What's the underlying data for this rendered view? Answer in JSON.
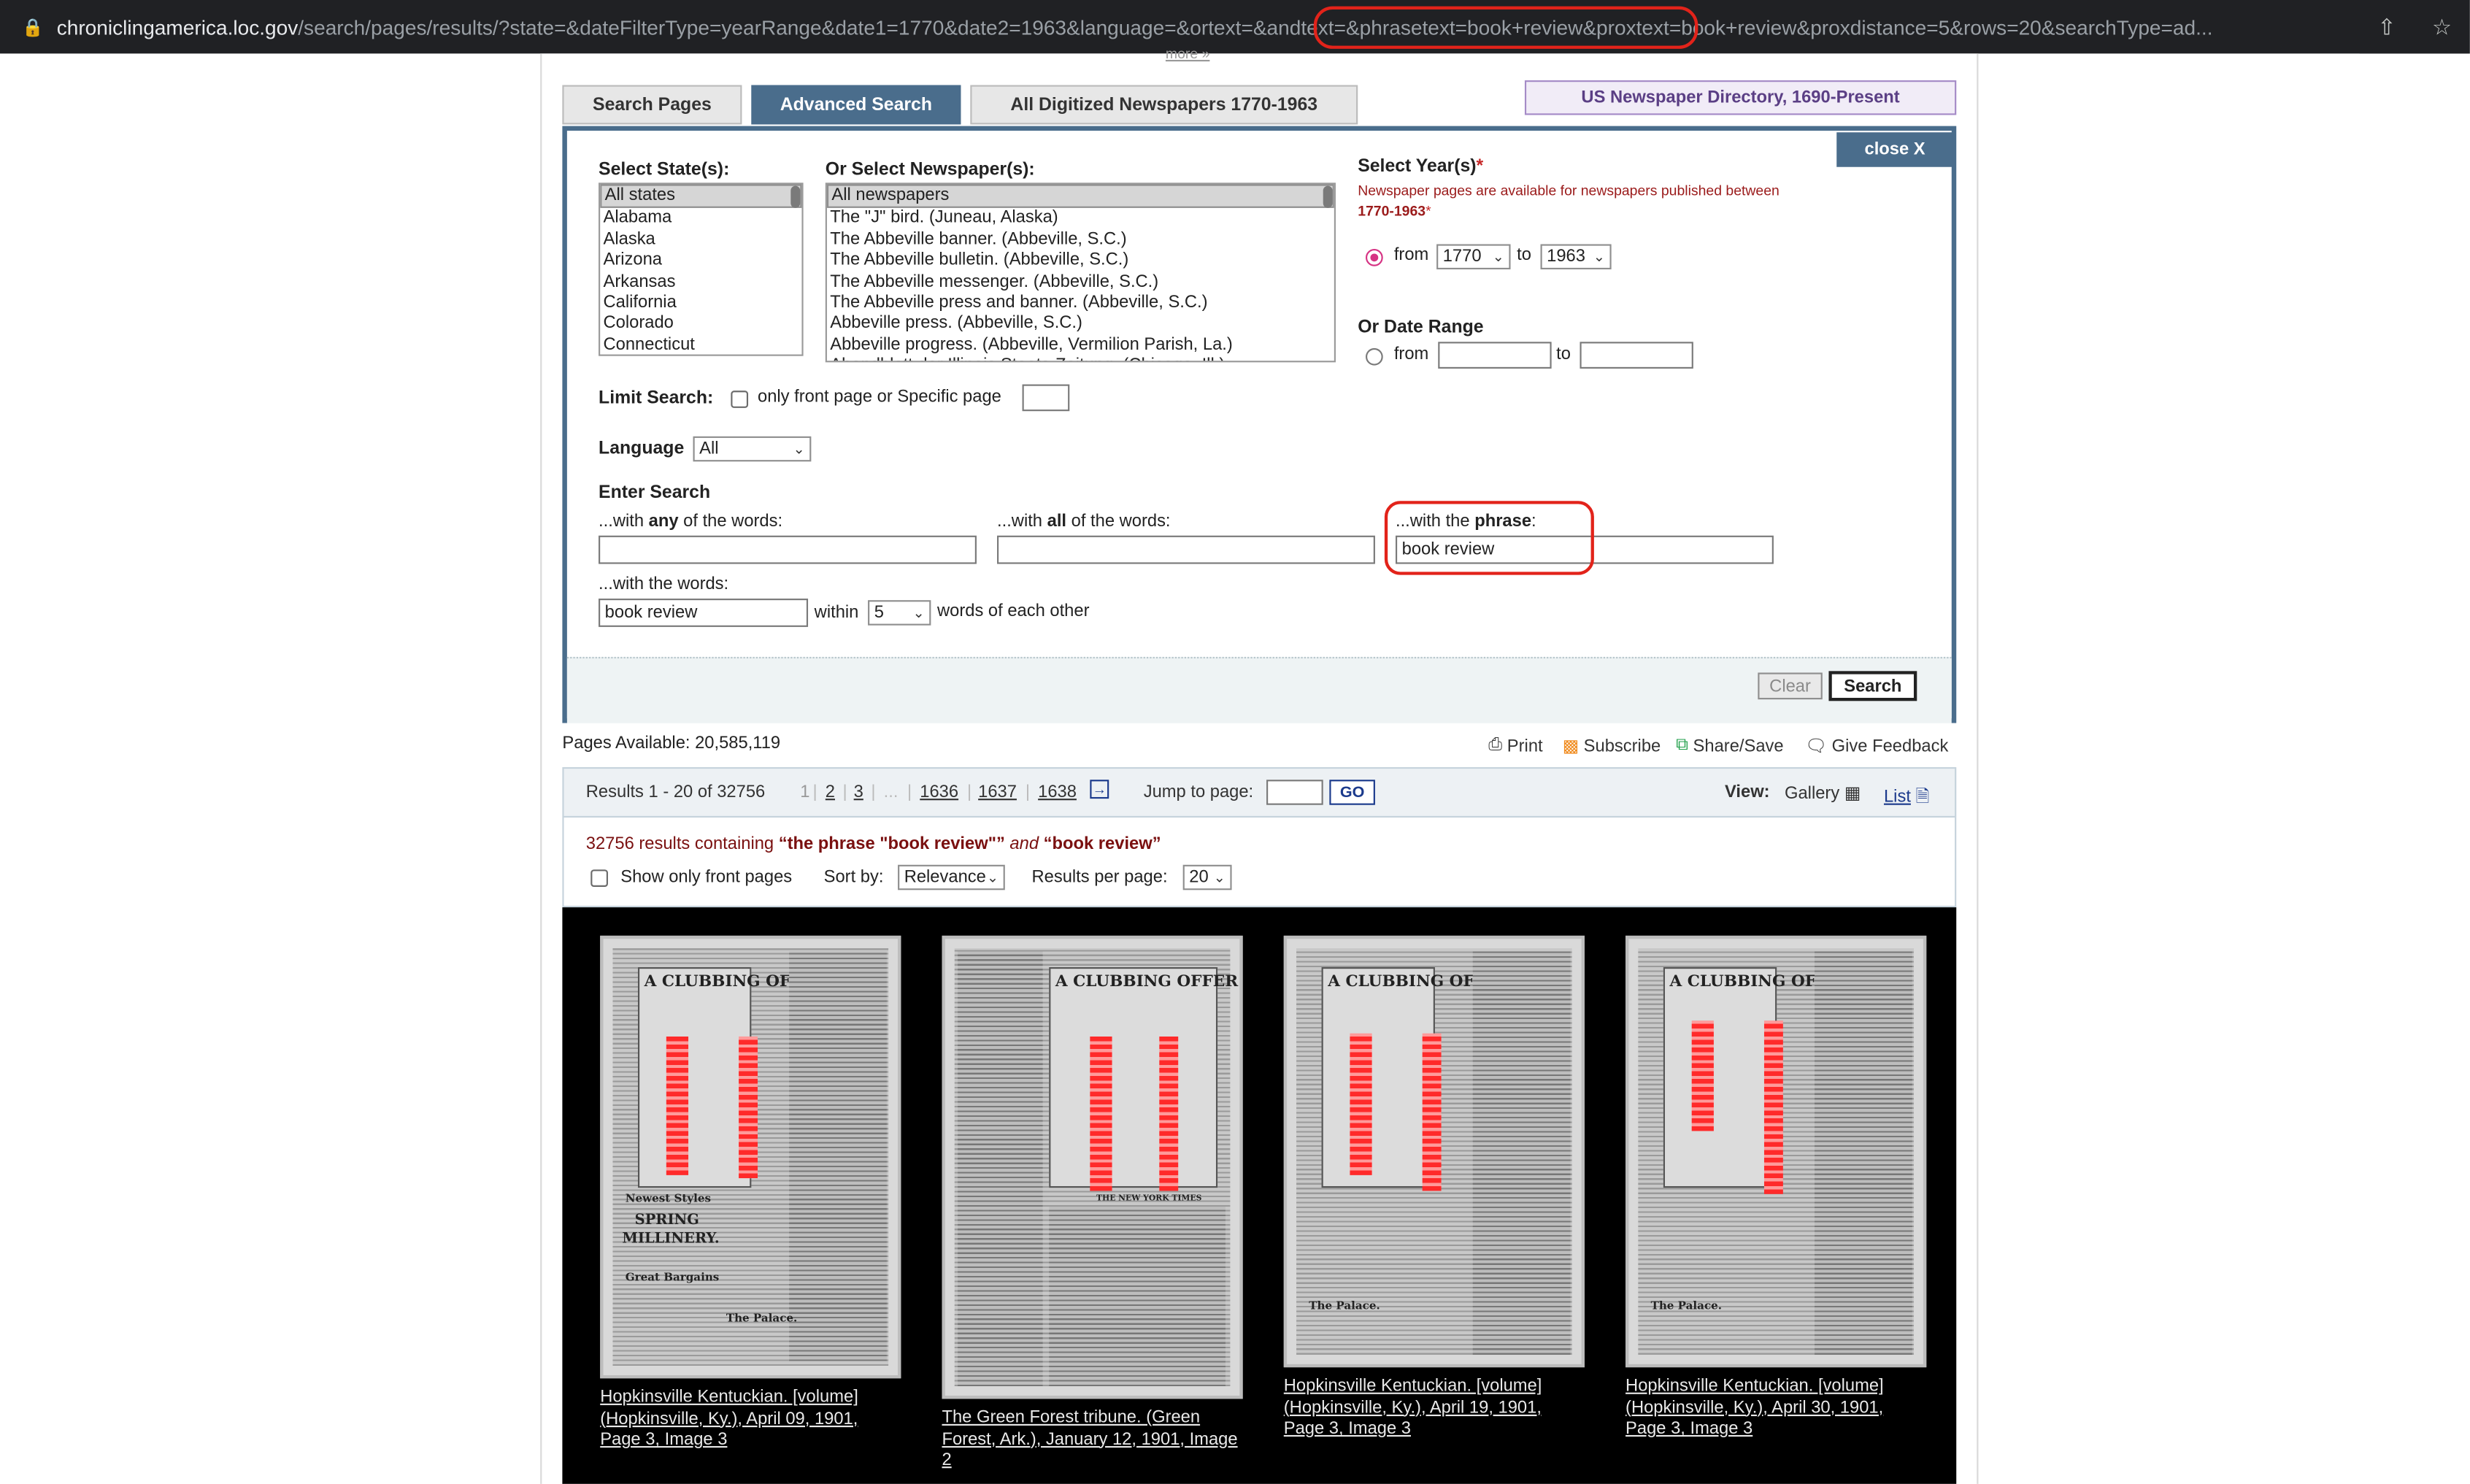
{
  "browser": {
    "url_host": "chroniclingamerica.loc.gov",
    "url_path": "/search/pages/results/?state=&dateFilterType=yearRange&date1=1770&date2=1963&language=&ortext=&andtext=&phrasetext=book+review&proxtext=book+review&proxdistance=5&rows=20&searchType=ad..."
  },
  "tabs": [
    "Search Pages",
    "Advanced Search",
    "All Digitized Newspapers 1770-1963"
  ],
  "directory_tab": "US Newspaper Directory, 1690-Present",
  "more_link": "more »",
  "panel": {
    "close_label": "close X",
    "states_label": "Select State(s):",
    "states": [
      "All states",
      "Alabama",
      "Alaska",
      "Arizona",
      "Arkansas",
      "California",
      "Colorado",
      "Connecticut"
    ],
    "newspapers_label": "Or Select Newspaper(s):",
    "newspapers": [
      "All newspapers",
      "The \"J\" bird. (Juneau, Alaska)",
      "The Abbeville banner. (Abbeville, S.C.)",
      "The Abbeville bulletin. (Abbeville, S.C.)",
      "The Abbeville messenger. (Abbeville, S.C.)",
      "The Abbeville press and banner. (Abbeville, S.C.)",
      "Abbeville press. (Abbeville, S.C.)",
      "Abbeville progress. (Abbeville, Vermilion Parish, La.)",
      "Abendblatt der Illinois Staats-Zeitung. (Chicago, Ill.)"
    ],
    "years_label": "Select Year(s)",
    "years_note": "Newspaper pages are available for newspapers published between",
    "years_range": "1770-1963",
    "from_label": "from",
    "to_label": "to",
    "year_from": "1770",
    "year_to": "1963",
    "date_range_label": "Or Date Range",
    "limit_label": "Limit Search:",
    "limit_text": "only front page or Specific page",
    "language_label": "Language",
    "language_value": "All",
    "enter_search_label": "Enter Search",
    "any_prefix": "...with ",
    "any_bold": "any",
    "any_suffix": " of the words:",
    "all_prefix": "...with ",
    "all_bold": "all",
    "all_suffix": " of the words:",
    "phrase_prefix": "...with the ",
    "phrase_bold": "phrase",
    "phrase_suffix": ":",
    "phrase_value": "book review",
    "words_label": "...with the words:",
    "words_value": "book review",
    "within_label": "within",
    "within_value": "5",
    "within_suffix": "words of each other",
    "clear_label": "Clear",
    "search_label": "Search"
  },
  "pages_available": "Pages Available: 20,585,119",
  "tools": {
    "print": "Print",
    "subscribe": "Subscribe",
    "share": "Share/Save",
    "feedback": "Give Feedback"
  },
  "results_bar": {
    "range": "Results 1 - 20 of 32756",
    "pages": [
      "1",
      "2",
      "3",
      "...",
      "1636",
      "1637",
      "1638"
    ],
    "jump_label": "Jump to page:",
    "go": "GO",
    "view_label": "View:",
    "gallery": "Gallery",
    "list": "List"
  },
  "summary": {
    "count": "32756 results containing ",
    "phrase": "“the phrase \"book review\"”",
    "and": " and ",
    "words": "“book review”"
  },
  "filters": {
    "front_only": "Show only front pages",
    "sort_label": "Sort by:",
    "sort_value": "Relevance",
    "per_page_label": "Results per page:",
    "per_page_value": "20"
  },
  "results": [
    {
      "caption": "Hopkinsville Kentuckian. [volume] (Hopkinsville, Ky.), April 09, 1901, Page 3, Image 3",
      "headline": "A CLUBBING OFFER",
      "extra": [
        "Newest Styles",
        "SPRING",
        "MILLINERY.",
        "Great Bargains",
        "The Palace."
      ]
    },
    {
      "caption": "The Green Forest tribune. (Green Forest, Ark.), January 12, 1901, Image 2",
      "headline": "A CLUBBING OFFER",
      "extra": [
        "THE NEW YORK TIMES"
      ]
    },
    {
      "caption": "Hopkinsville Kentuckian. [volume] (Hopkinsville, Ky.), April 19, 1901, Page 3, Image 3",
      "headline": "A CLUBBING OFFER",
      "extra": [
        "The Palace."
      ]
    },
    {
      "caption": "Hopkinsville Kentuckian. [volume] (Hopkinsville, Ky.), April 30, 1901, Page 3, Image 3",
      "headline": "A CLUBBING OFFER",
      "extra": [
        "The Palace."
      ]
    }
  ]
}
